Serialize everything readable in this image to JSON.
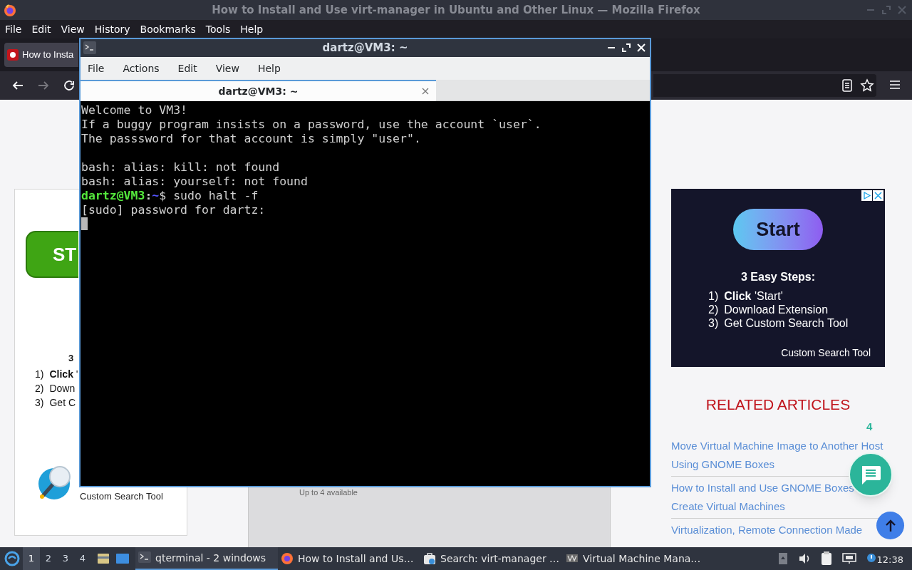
{
  "firefox": {
    "title": "How to Install and Use virt-manager in Ubuntu and Other Linux — Mozilla Firefox",
    "menu": [
      "File",
      "Edit",
      "View",
      "History",
      "Bookmarks",
      "Tools",
      "Help"
    ],
    "tab": {
      "title": "How to Insta"
    }
  },
  "page": {
    "left_ad": {
      "button": "ST",
      "heading": "3",
      "steps": [
        {
          "number": "1)",
          "text": "**Click** '"
        },
        {
          "number": "2)",
          "text": "Down"
        },
        {
          "number": "3)",
          "text": "Get C"
        }
      ],
      "footer": "Custom Search Tool"
    },
    "middle": {
      "note": "Up to 4 available"
    },
    "right_ad": {
      "button": "Start",
      "heading": "3 Easy Steps:",
      "steps": [
        {
          "number": "1)",
          "text": "**Click** 'Start'"
        },
        {
          "number": "2)",
          "text": "Download Extension"
        },
        {
          "number": "3)",
          "text": "Get Custom Search Tool"
        }
      ],
      "footer": "Custom Search Tool"
    },
    "related": {
      "heading": "RELATED ARTICLES",
      "links": [
        {
          "lines": [
            "Move Virtual Machine Image to Another Host",
            "Using GNOME Boxes"
          ]
        },
        {
          "lines": [
            "How to Install and Use GNOME Boxes",
            "Create Virtual Machines"
          ]
        },
        {
          "lines": [
            "Virtualization, Remote Connection Made"
          ]
        }
      ]
    },
    "chat_badge": "4"
  },
  "terminal": {
    "title": "dartz@VM3: ~",
    "menu": [
      "File",
      "Actions",
      "Edit",
      "View",
      "Help"
    ],
    "tabs": [
      {
        "title": "dartz@VM3: ~",
        "selected": true
      }
    ],
    "lines": [
      {
        "kind": "text",
        "text": "Welcome to VM3!"
      },
      {
        "kind": "text",
        "text": "If a buggy program insists on a password, use the account `user`."
      },
      {
        "kind": "text",
        "text": "The passsword for that account is simply \"user\"."
      },
      {
        "kind": "blank"
      },
      {
        "kind": "text",
        "text": "bash: alias: kill: not found"
      },
      {
        "kind": "text",
        "text": "bash: alias: yourself: not found"
      },
      {
        "kind": "prompt",
        "user": "dartz@VM3",
        "separator": ":",
        "path": "~",
        "symbol": "$",
        "command": " sudo halt -f"
      },
      {
        "kind": "text",
        "text": "[sudo] password for dartz:"
      },
      {
        "kind": "cursor"
      }
    ]
  },
  "taskbar": {
    "workspaces": [
      {
        "label": "1",
        "selected": true
      },
      {
        "label": "2",
        "selected": false
      },
      {
        "label": "3",
        "selected": false
      },
      {
        "label": "4",
        "selected": false
      }
    ],
    "tasks": [
      {
        "kind": "terminal",
        "label": "qterminal - 2 windows",
        "selected": true
      },
      {
        "kind": "browser",
        "label": "How to Install and Us…",
        "selected": false
      },
      {
        "kind": "search",
        "label": "Search: virt-manager …",
        "selected": false
      },
      {
        "kind": "virt",
        "label": "Virtual Machine Mana…",
        "selected": false
      }
    ],
    "clock": "12:38"
  }
}
